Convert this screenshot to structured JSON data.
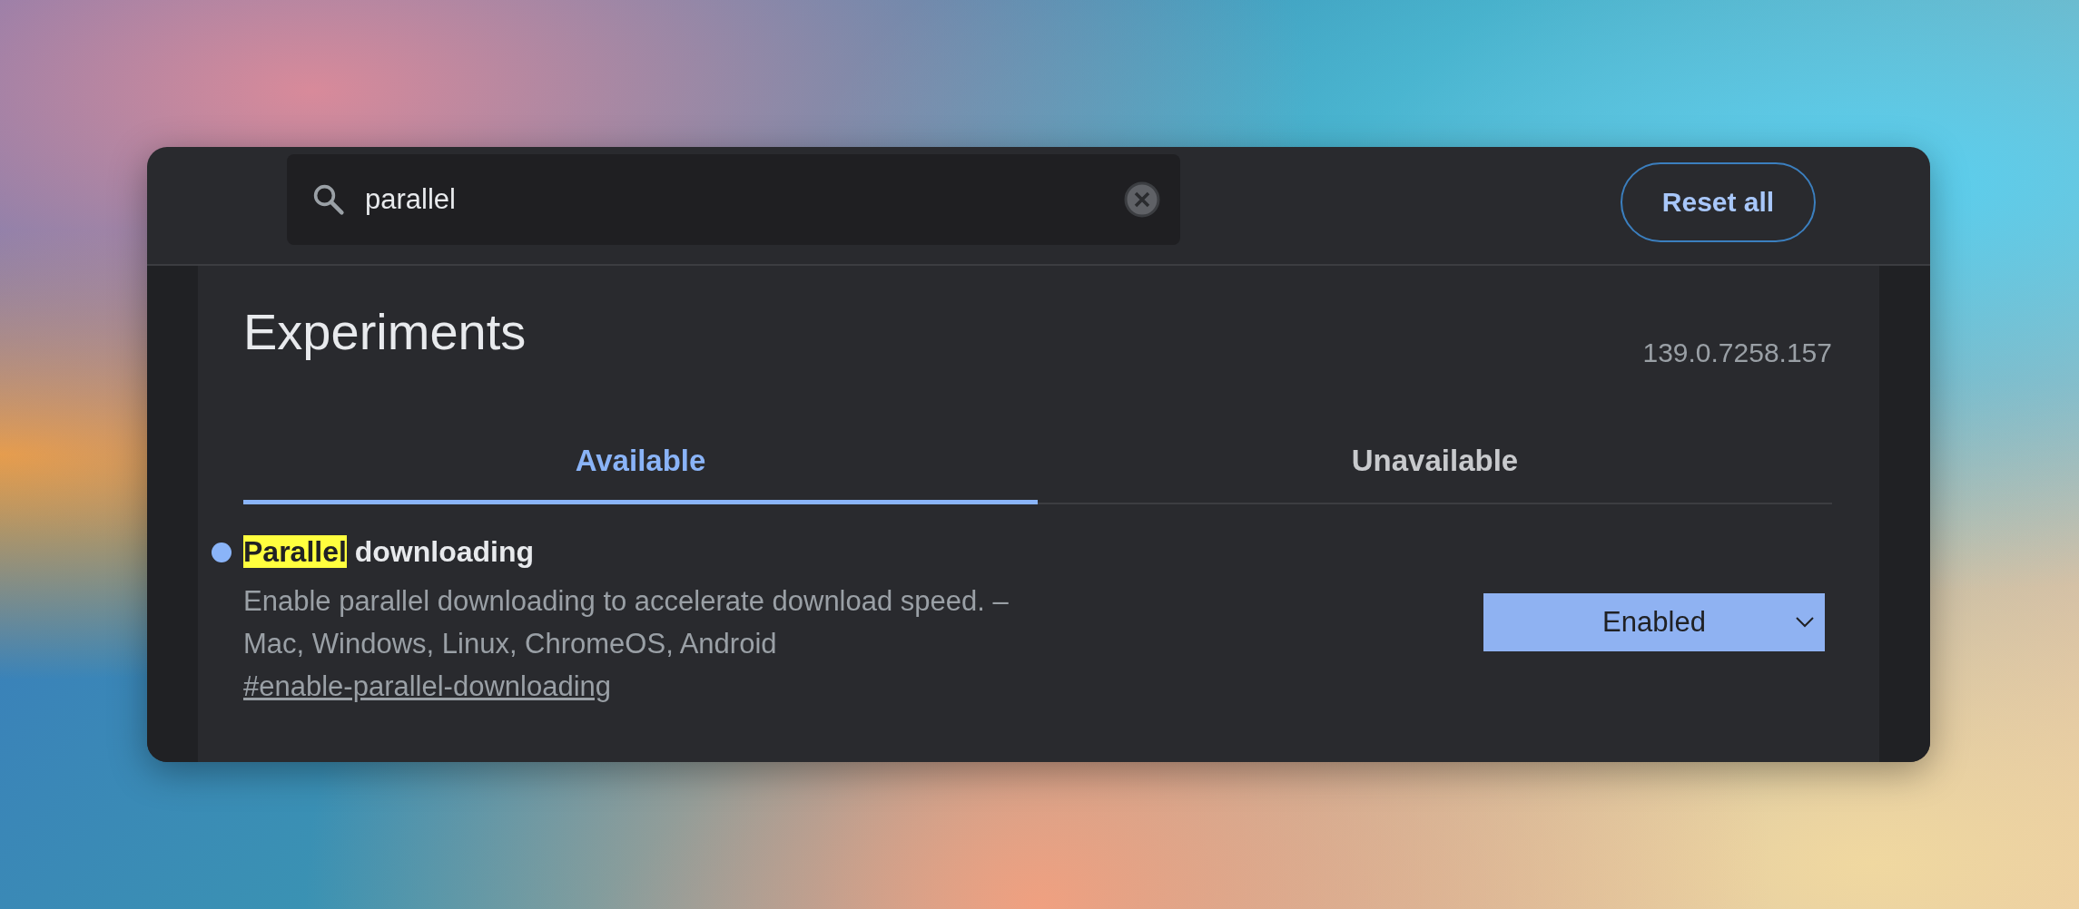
{
  "search": {
    "value": "parallel"
  },
  "reset_button": "Reset all",
  "page": {
    "title": "Experiments",
    "version": "139.0.7258.157"
  },
  "tabs": [
    {
      "label": "Available",
      "selected": true
    },
    {
      "label": "Unavailable",
      "selected": false
    }
  ],
  "flags": [
    {
      "title_parts": [
        {
          "text": "Parallel",
          "highlighted": true
        },
        {
          "text": " downloading",
          "highlighted": false
        }
      ],
      "modified": true,
      "description": "Enable parallel downloading to accelerate download speed. – Mac, Windows, Linux, ChromeOS, Android",
      "link": "#enable-parallel-downloading",
      "value": "Enabled"
    }
  ]
}
